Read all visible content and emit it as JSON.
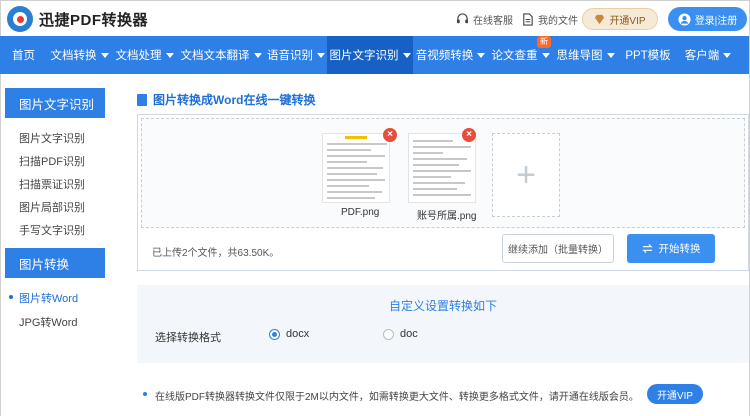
{
  "header": {
    "logo_text": "迅捷PDF转换器",
    "service_label": "在线客服",
    "files_label": "我的文件",
    "vip_label": "开通VIP",
    "login_label": "登录|注册"
  },
  "nav": {
    "items": [
      {
        "label": "首页"
      },
      {
        "label": "文档转换"
      },
      {
        "label": "文档处理"
      },
      {
        "label": "文档文本翻译"
      },
      {
        "label": "语音识别"
      },
      {
        "label": "图片文字识别"
      },
      {
        "label": "音视频转换"
      },
      {
        "label": "论文查重"
      },
      {
        "label": "思维导图"
      },
      {
        "label": "PPT模板"
      },
      {
        "label": "客户端"
      }
    ],
    "new_badge": "新"
  },
  "sidebar": {
    "section1_title": "图片文字识别",
    "section1_items": [
      "图片文字识别",
      "扫描PDF识别",
      "扫描票证识别",
      "图片局部识别",
      "手写文字识别"
    ],
    "section2_title": "图片转换",
    "section2_items": [
      "图片转Word",
      "JPG转Word"
    ]
  },
  "main": {
    "title": "图片转换成Word在线一键转换",
    "files": [
      {
        "name": "PDF.png"
      },
      {
        "name": "账号所属.png"
      }
    ],
    "upload_info": "已上传2个文件，共63.50K。",
    "continue_label": "继续添加（批量转换）",
    "start_label": "开始转换"
  },
  "settings": {
    "title": "自定义设置转换如下",
    "label": "选择转换格式",
    "options": [
      "docx",
      "doc"
    ],
    "selected": "docx"
  },
  "notice": {
    "text": "在线版PDF转换器转换文件仅限于2M以内文件，如需转换更大文件、转换更多格式文件，请开通在线版会员。",
    "vip_label": "开通VIP"
  },
  "colors": {
    "brand_blue": "#2e7fe6",
    "nav_active": "#1761c4",
    "close_red": "#e74c3c",
    "vip_gold": "#f6e9d6"
  }
}
